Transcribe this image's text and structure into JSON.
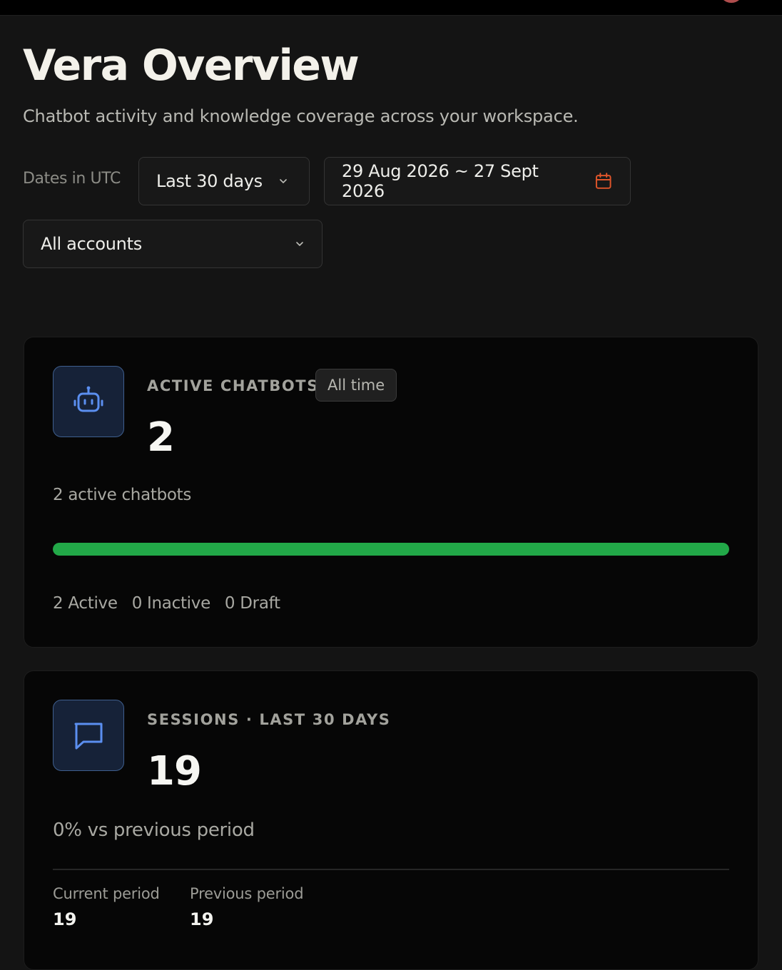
{
  "header": {
    "title": "Vera Overview",
    "subtitle": "Chatbot activity and knowledge coverage across your workspace."
  },
  "filters": {
    "dates_label": "Dates in UTC",
    "range_selected": "Last 30 days",
    "date_range": "29 Aug 2026 ~ 27 Sept 2026",
    "account_selected": "All accounts"
  },
  "chatbots_card": {
    "icon": "robot-icon",
    "label": "Active chatbots",
    "badge": "All time",
    "value": "2",
    "note": "2 active chatbots",
    "active_fraction": 1.0,
    "status": {
      "active": "2 Active",
      "inactive": "0 Inactive",
      "draft": "0 Draft"
    }
  },
  "sessions_card": {
    "icon": "message-icon",
    "label": "Sessions · Last 30 days",
    "value": "19",
    "note": "0% vs previous period",
    "current_label": "Current period",
    "current_value": "19",
    "previous_label": "Previous period",
    "previous_value": "19"
  },
  "colors": {
    "background": "#141414",
    "card": "#060606",
    "accent_blue": "#5b8ff0",
    "progress_green": "#22a848",
    "calendar_orange": "#e0552a"
  }
}
